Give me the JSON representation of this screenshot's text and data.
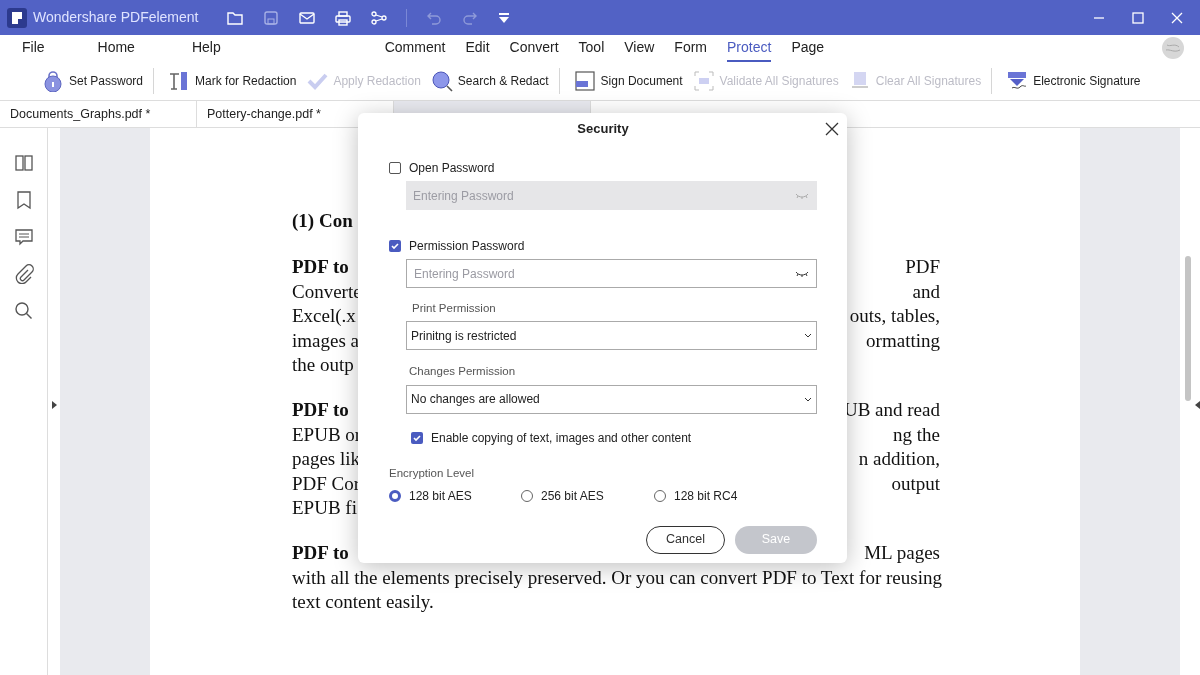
{
  "window": {
    "title": "Wondershare PDFelement"
  },
  "menu": {
    "left": [
      {
        "label": "File",
        "selected": false
      },
      {
        "label": "Home",
        "selected": false
      },
      {
        "label": "Help",
        "selected": false
      }
    ],
    "center": [
      {
        "label": "Comment",
        "selected": false
      },
      {
        "label": "Edit",
        "selected": false
      },
      {
        "label": "Convert",
        "selected": false
      },
      {
        "label": "Tool",
        "selected": false
      },
      {
        "label": "View",
        "selected": false
      },
      {
        "label": "Form",
        "selected": false
      },
      {
        "label": "Protect",
        "selected": true
      },
      {
        "label": "Page",
        "selected": false
      }
    ]
  },
  "toolbar": [
    {
      "label": "Set Password",
      "disabled": false,
      "divider_after": true
    },
    {
      "label": "Mark for Redaction",
      "disabled": false,
      "divider_after": false
    },
    {
      "label": "Apply Redaction",
      "disabled": true,
      "divider_after": false
    },
    {
      "label": "Search & Redact",
      "disabled": false,
      "divider_after": true
    },
    {
      "label": "Sign Document",
      "disabled": false,
      "divider_after": false
    },
    {
      "label": "Validate All Signatures",
      "disabled": true,
      "divider_after": false
    },
    {
      "label": "Clear All Signatures",
      "disabled": true,
      "divider_after": true
    },
    {
      "label": "Electronic Signature",
      "disabled": false,
      "divider_after": false
    }
  ],
  "tabs": [
    {
      "label": "Documents_Graphs.pdf *",
      "selected": false
    },
    {
      "label": "Pottery-change.pdf *",
      "selected": false
    },
    {
      "selected": true
    }
  ],
  "document": {
    "blocks": [
      {
        "kind": "heading",
        "lines": [
          {
            "left": "(1) Con"
          }
        ]
      },
      {
        "kind": "paragraph",
        "lines": [
          {
            "left": "PDF to",
            "bold": true,
            "right": "PDF"
          },
          {
            "left": "Converte",
            "right": "and"
          },
          {
            "left": "Excel(.x",
            "right": "outs, tables,"
          },
          {
            "left": "images a",
            "right": "ormatting"
          },
          {
            "left": "the outp"
          }
        ]
      },
      {
        "kind": "paragraph",
        "lines": [
          {
            "left": "PDF to",
            "bold": true,
            "right": "UB and read"
          },
          {
            "left": "EPUB or",
            "right": "ng the"
          },
          {
            "left": "pages lik",
            "right": "n addition,"
          },
          {
            "left": "PDF Cor",
            "right": "output"
          },
          {
            "left": "EPUB fi"
          }
        ]
      },
      {
        "kind": "paragraph",
        "lines": [
          {
            "left": "PDF to",
            "bold": true,
            "right": "ML pages"
          },
          {
            "left": "with all the elements precisely preserved. Or you can convert PDF to Text for reusing"
          },
          {
            "left": "text content easily."
          }
        ]
      }
    ]
  },
  "dialog": {
    "title": "Security",
    "open_password": {
      "label": "Open Password",
      "checked": false,
      "placeholder": "Entering Password"
    },
    "permission_password": {
      "label": "Permission Password",
      "checked": true,
      "placeholder": "Entering Password"
    },
    "print_permission": {
      "label": "Print Permission",
      "value": "Prinitng is restricted"
    },
    "changes_permission": {
      "label": "Changes Permission",
      "value": "No changes are allowed"
    },
    "copy_option": {
      "label": "Enable copying of text, images and other content",
      "checked": true
    },
    "encryption": {
      "label": "Encryption Level",
      "options": [
        {
          "label": "128 bit AES",
          "selected": true
        },
        {
          "label": "256 bit AES",
          "selected": false
        },
        {
          "label": "128 bit RC4",
          "selected": false
        }
      ]
    },
    "buttons": [
      {
        "kind": "cancel",
        "label": "Cancel",
        "disabled": false
      },
      {
        "kind": "save",
        "label": "Save",
        "disabled": true
      }
    ]
  }
}
